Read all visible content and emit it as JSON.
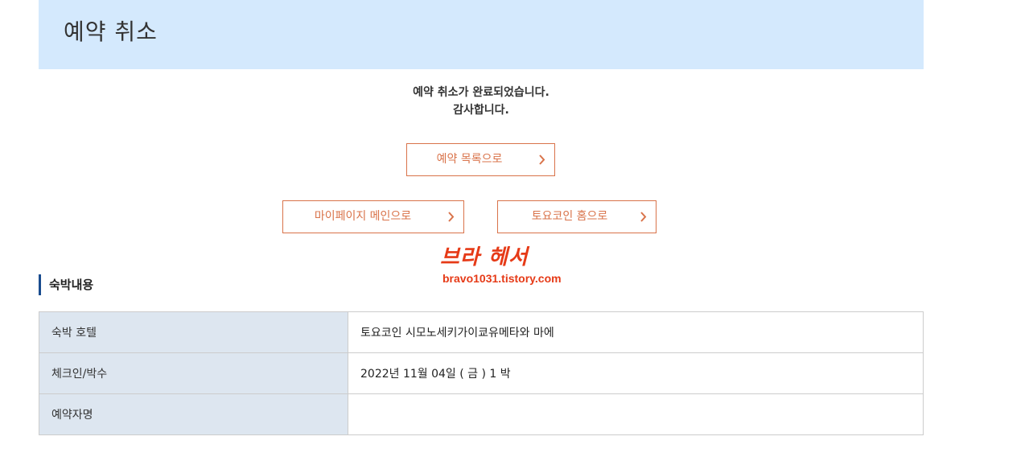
{
  "header": {
    "title": "예약 취소"
  },
  "message": {
    "line1": "예약 취소가 완료되었습니다.",
    "line2": "감사합니다."
  },
  "buttons": {
    "reservation_list": "예약 목록으로",
    "mypage_main": "마이페이지 메인으로",
    "toyoko_home": "토요코인 홈으로"
  },
  "watermark": {
    "title": "브라 헤서",
    "url": "bravo1031.tistory.com"
  },
  "section": {
    "title": "숙박내용"
  },
  "details": {
    "rows": [
      {
        "label": "숙박 호텔",
        "value": "토요코인 시모노세키가이쿄유메타와 마에"
      },
      {
        "label": "체크인/박수",
        "value": "2022년 11월 04일 ( 금 )  1 박"
      },
      {
        "label": "예약자명",
        "value": ""
      }
    ]
  },
  "colors": {
    "header_bg": "#d4e9fd",
    "accent": "#d9734a",
    "section_bar": "#1a4d8f",
    "table_header_bg": "#dde6f0",
    "watermark": "#e63a17"
  }
}
